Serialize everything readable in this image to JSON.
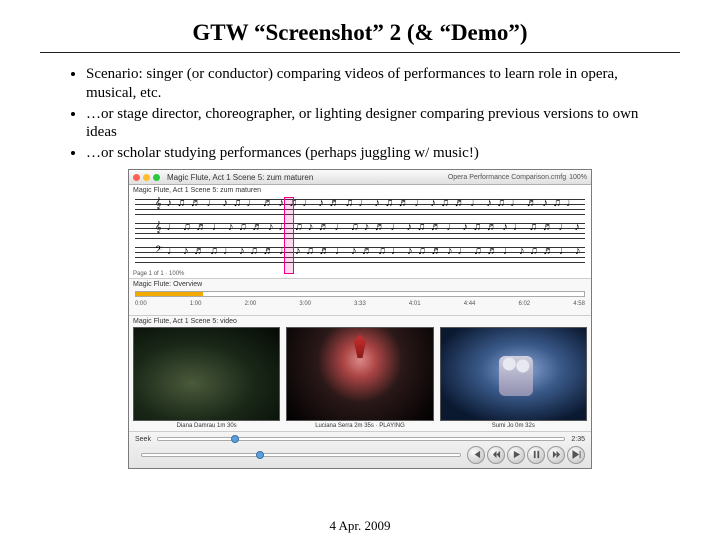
{
  "title": "GTW “Screenshot” 2 (& “Demo”)",
  "bullets": [
    "Scenario: singer (or conductor) comparing videos of performances to learn role in opera, musical, etc.",
    "…or stage director, choreographer, or lighting designer comparing previous versions to own ideas",
    "…or scholar studying performances (perhaps juggling w/ music!)"
  ],
  "app": {
    "window_title": "Magic Flute, Act 1 Scene 5: zum maturen",
    "doc_badge": "Opera Performance Comparison.cmfg",
    "zoom": "100%",
    "score_status": "Page 1 of 1 · 100%",
    "overview_label": "Magic Flute: Overview",
    "overview_ticks": [
      "0:00",
      "1:00",
      "2:00",
      "3:00",
      "3:33",
      "4:01",
      "4:44",
      "6:02",
      "4:58"
    ],
    "video_label": "Magic Flute, Act 1 Scene 5: video",
    "videos": [
      {
        "caption": "Diana Damrau 1m 30s"
      },
      {
        "caption": "Luciana Serra 2m 35s · PLAYING"
      },
      {
        "caption": "Sumi Jo 0m 32s"
      }
    ],
    "seek_label": "Seek",
    "seek_time": "2:35",
    "seek_pos_a": "18%",
    "seek_pos_b": "36%"
  },
  "date": "4 Apr. 2009"
}
